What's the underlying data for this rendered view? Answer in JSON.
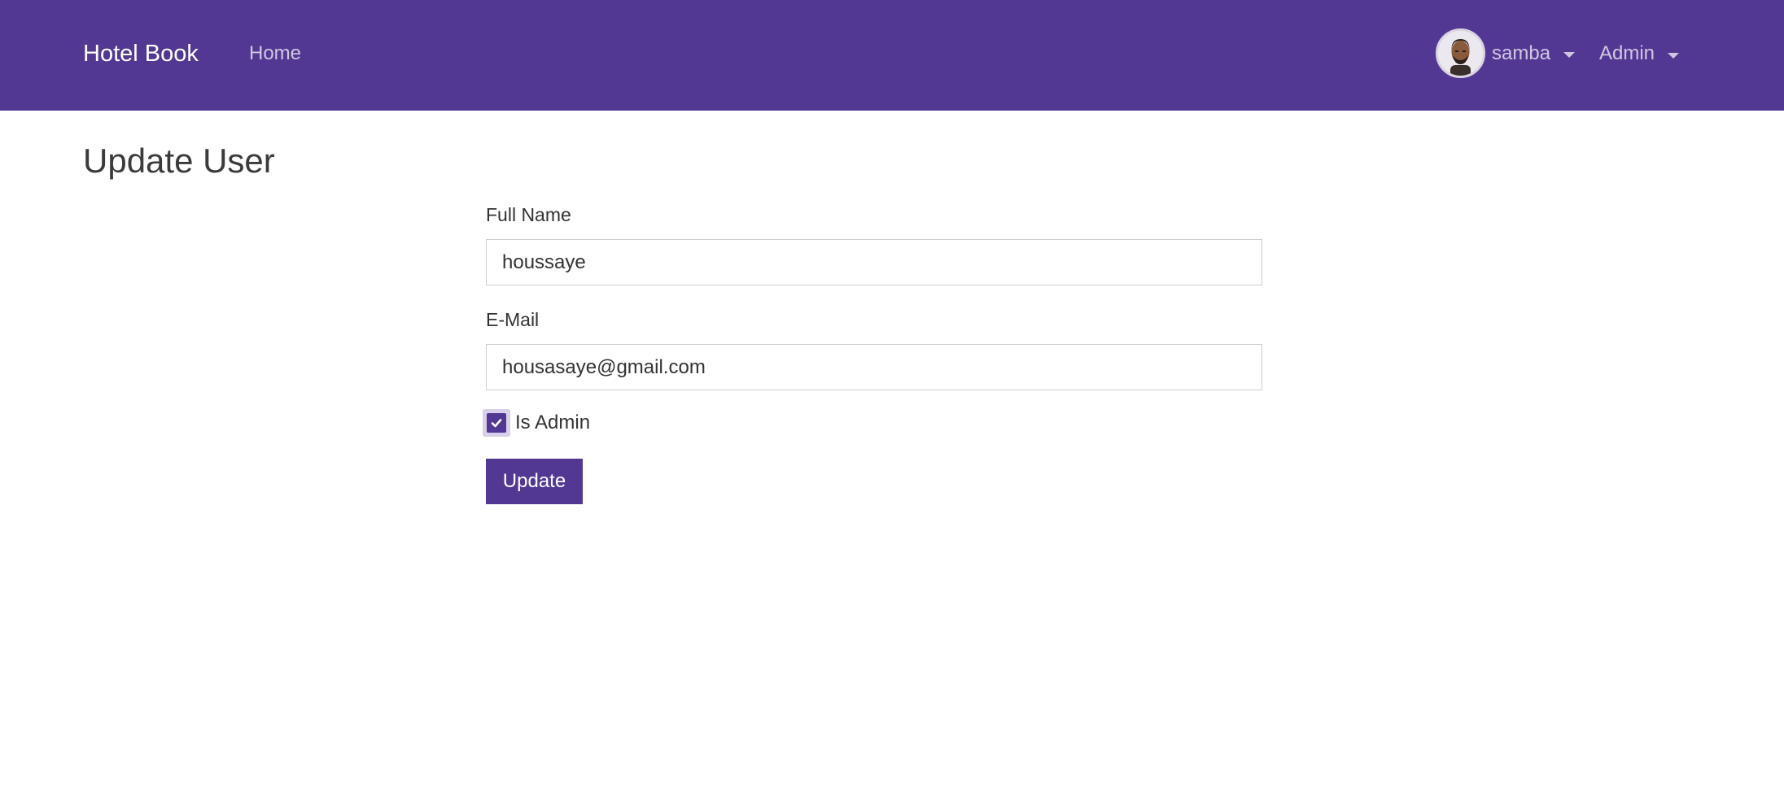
{
  "navbar": {
    "brand": "Hotel Book",
    "home_label": "Home",
    "user_name": "samba",
    "admin_label": "Admin"
  },
  "page": {
    "title": "Update User"
  },
  "form": {
    "full_name_label": "Full Name",
    "full_name_value": "houssaye",
    "email_label": "E-Mail",
    "email_value": "housasaye@gmail.com",
    "is_admin_label": "Is Admin",
    "is_admin_checked": true,
    "submit_label": "Update"
  },
  "icons": {
    "user_menu_caret": "caret-down-icon",
    "admin_menu_caret": "caret-down-icon",
    "checkbox_check": "check-icon"
  },
  "colors": {
    "brand_purple": "#533893",
    "checkbox_focus_ring": "#d8cfe8"
  }
}
